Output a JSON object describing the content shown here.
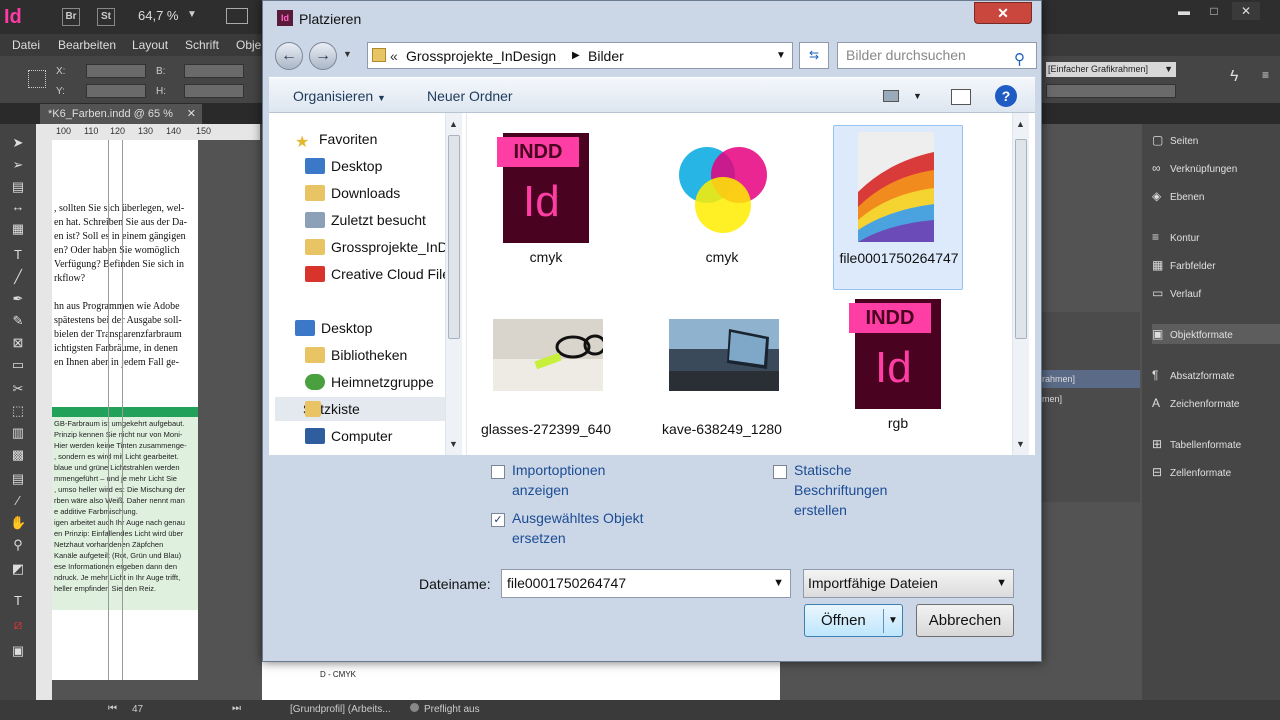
{
  "app": {
    "logo": "Id",
    "br_label": "Br",
    "st_label": "St",
    "zoom": "64,7 %",
    "menu": [
      "Datei",
      "Bearbeiten",
      "Layout",
      "Schrift",
      "Obje"
    ],
    "ctrl": {
      "x": "X:",
      "y": "Y:",
      "b": "B:",
      "h": "H:"
    },
    "frame_style": "[Einfacher Grafikrahmen]",
    "doc_tab": "*K6_Farben.indd @ 65 %",
    "ruler": [
      "100",
      "110",
      "120",
      "130",
      "140",
      "150"
    ],
    "page_lines": [
      ", sollten Sie sich überlegen, wel-",
      "en hat. Schreiben Sie aus der Da-",
      "en ist? Soll es in einem gängigen",
      "en? Oder haben Sie womöglich",
      "Verfügung? Befinden Sie sich in",
      "rkflow?",
      "",
      "hn aus Programmen wie Adobe",
      "spätestens bei der Ausgabe soll-",
      "bielen der Transparenzfarbraum",
      "ichtigsten Farbräume, in denen",
      "en Ihnen aber in jedem Fall ge-"
    ],
    "green_lines": [
      "GB-Farbraum ist umgekehrt aufgebaut.",
      "Prinzip kennen Sie nicht nur von Moni-",
      "Hier werden keine Tinten zusammenge-",
      ", sondern es wird mit Licht gearbeitet.",
      "blaue und grüne Lichtstrahlen werden",
      "mmengeführt – und je mehr Licht Sie",
      ", umso heller wird es: Die Mischung der",
      "rben wäre also Weiß. Daher nennt man",
      "e additive Farbmischung.",
      "igen arbeitet auch Ihr Auge nach genau",
      "en Prinzip: Einfallendes Licht wird über",
      "Netzhaut vorhandenen Zäpfchen",
      "Kanäle aufgeteilt (Rot, Grün und Blau)",
      "ese Informationen ergeben dann den",
      "ndruck. Je mehr Licht in Ihr Auge trifft,",
      "heller empfinden Sie den Reiz."
    ],
    "bottom_label": "D - CMYK",
    "status": {
      "page": "47",
      "profile": "[Grundprofil] (Arbeits...",
      "preflight": "Preflight aus"
    },
    "panels": [
      "Seiten",
      "Verknüpfungen",
      "Ebenen",
      "Kontur",
      "Farbfelder",
      "Verlauf",
      "Objektformate",
      "Absatzformate",
      "Zeichenformate",
      "Tabellenformate",
      "Zellenformate"
    ],
    "mid_rows": [
      "rahmen]",
      "men]"
    ]
  },
  "dialog": {
    "title": "Platzieren",
    "close": "✕",
    "breadcrumb": [
      "Grossprojekte_InDesign",
      "Bilder"
    ],
    "search_placeholder": "Bilder durchsuchen",
    "organize": "Organisieren",
    "new_folder": "Neuer Ordner",
    "help": "?",
    "nav": {
      "favorites_header": "Favoriten",
      "favorites": [
        "Desktop",
        "Downloads",
        "Zuletzt besucht",
        "Grossprojekte_InDesign",
        "Creative Cloud Files"
      ],
      "desktop_header": "Desktop",
      "desktop": [
        "Bibliotheken",
        "Heimnetzgruppe",
        "Satzkiste",
        "Computer"
      ]
    },
    "files": [
      {
        "name": "cmyk",
        "type": "indd"
      },
      {
        "name": "cmyk",
        "type": "image-cmyk"
      },
      {
        "name": "file0001750264747",
        "type": "image-swatches"
      },
      {
        "name": "glasses-272399_640",
        "type": "image-glasses"
      },
      {
        "name": "kave-638249_1280",
        "type": "image-laptop"
      },
      {
        "name": "rgb",
        "type": "indd"
      }
    ],
    "indd_tag": "INDD",
    "indd_logo": "Id",
    "options": {
      "import_options": "Importoptionen anzeigen",
      "replace_selected": "Ausgewähltes Objekt ersetzen",
      "static_captions": "Statische Beschriftungen erstellen",
      "import_options_checked": false,
      "replace_selected_checked": true,
      "static_captions_checked": false
    },
    "filename_label": "Dateiname:",
    "filename_value": "file0001750264747",
    "filter": "Importfähige Dateien",
    "open": "Öffnen",
    "cancel": "Abbrechen"
  }
}
